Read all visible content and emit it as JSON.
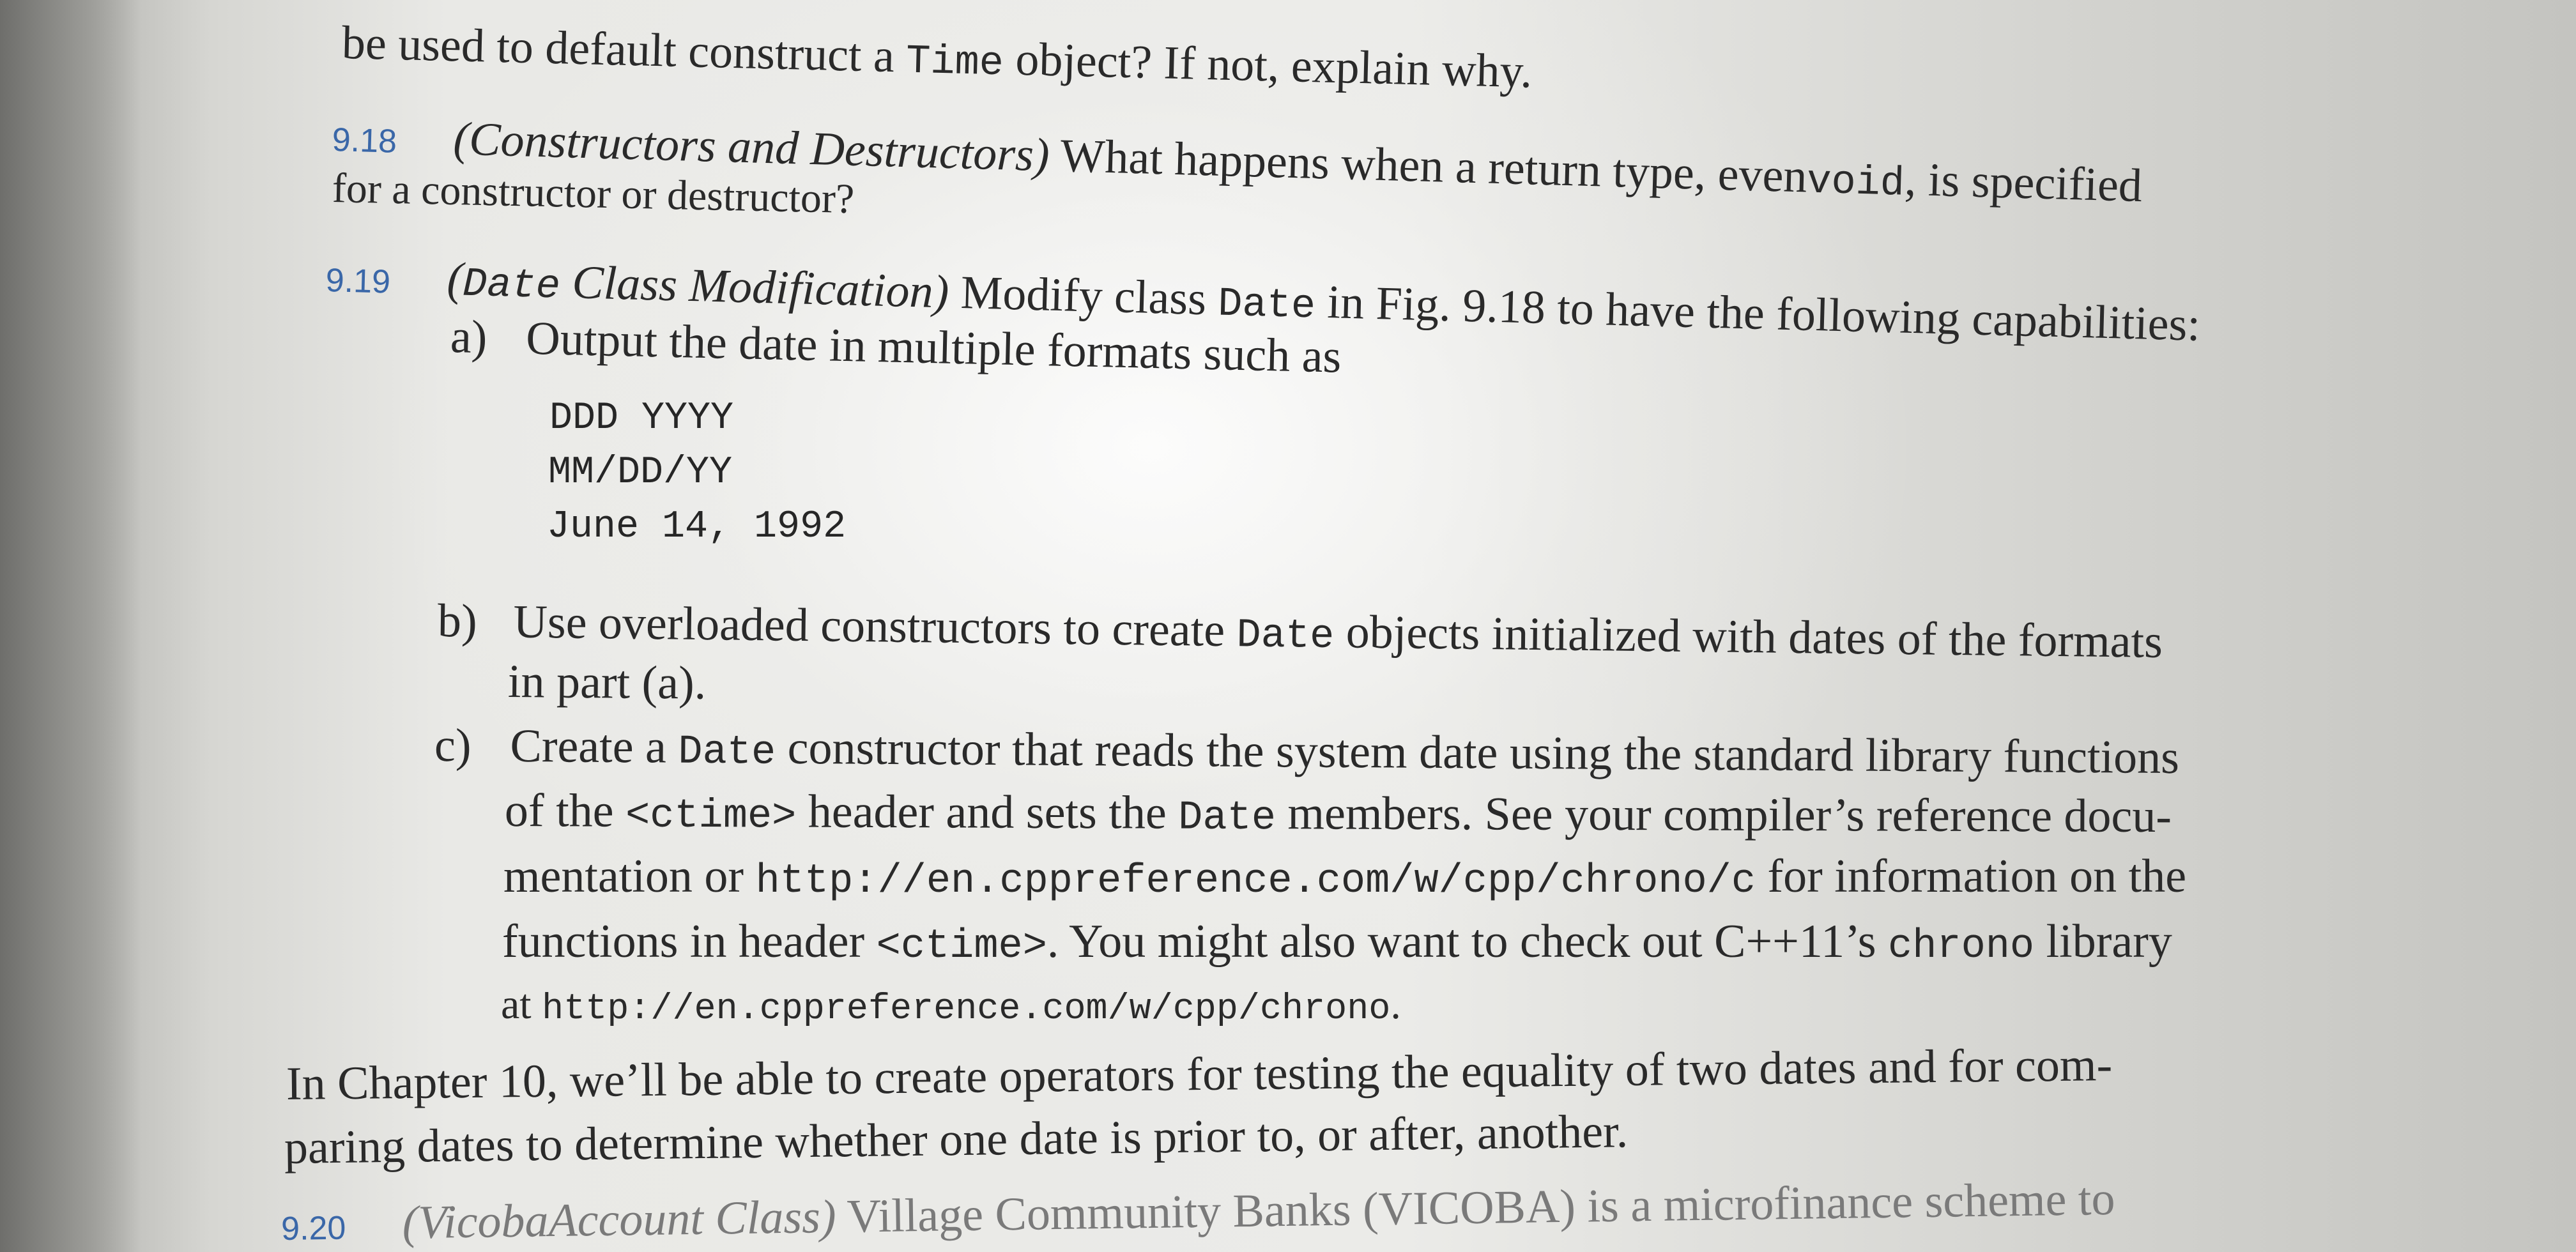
{
  "lines": {
    "l1": "be used to default construct a",
    "l1_code": "Time",
    "l1_end": "object? If not, explain why.",
    "p918_num": "9.18",
    "p918_title": "(Constructors and Destructors)",
    "p918_text": "What happens when a return type, even",
    "p918_code": "void",
    "p918_end": ", is specified",
    "p918_line2": "for a constructor or destructor?",
    "p919_num": "9.19",
    "p919_title_open": "(",
    "p919_title_code": "Date",
    "p919_title_rest": "Class Modification)",
    "p919_text": "Modify class",
    "p919_code": "Date",
    "p919_end": "in Fig. 9.18 to have the following capabilities:",
    "a_letter": "a)",
    "a_text": "Output the date in multiple formats such as",
    "code1": "DDD YYYY",
    "code2": "MM/DD/YY",
    "code3": "June 14, 1992",
    "b_letter": "b)",
    "b_text1": "Use overloaded constructors to create",
    "b_code": "Date",
    "b_text2": "objects initialized with dates of the formats",
    "b_line2": "in part (a).",
    "c_letter": "c)",
    "c_text1": "Create a",
    "c_code1": "Date",
    "c_text2": "constructor that reads the system date using the standard library functions",
    "c2_text1": "of the",
    "c2_code1": "<ctime>",
    "c2_text2": "header and sets the",
    "c2_code2": "Date",
    "c2_text3": "members. See your compiler’s reference docu-",
    "c3_text1": "mentation or",
    "c3_code1": "http://en.cppreference.com/w/cpp/chrono/c",
    "c3_text2": "for information on the",
    "c4_text1": "functions in header",
    "c4_code1": "<ctime>",
    "c4_text2": ". You might also want to check out C++11’s",
    "c4_code2": "chrono",
    "c4_text3": "library",
    "c5_text1": "at",
    "c5_code1": "http://en.cppreference.com/w/cpp/chrono",
    "c5_text2": ".",
    "ch10_line1": "In Chapter 10, we’ll be able to create operators for testing the equality of two dates and for com-",
    "ch10_line2": "paring dates to determine whether one date is prior to, or after, another.",
    "p920_num": "9.20",
    "p920_title": "(VicobaAccount Class)",
    "p920_text": "Village Community Banks (VICOBA) is a microfinance scheme to"
  }
}
